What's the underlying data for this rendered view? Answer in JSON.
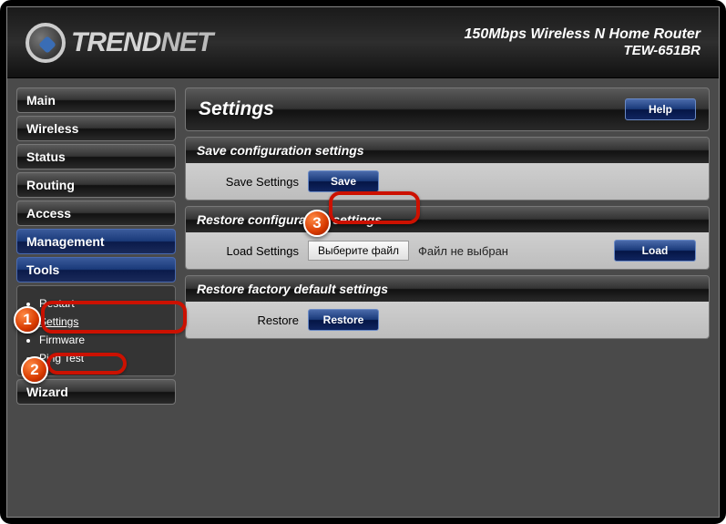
{
  "header": {
    "brand": "TRENDNET",
    "brand_part1": "TREND",
    "brand_part2": "NET",
    "line1": "150Mbps Wireless N Home Router",
    "line2": "TEW-651BR"
  },
  "nav": {
    "items": [
      {
        "label": "Main"
      },
      {
        "label": "Wireless"
      },
      {
        "label": "Status"
      },
      {
        "label": "Routing"
      },
      {
        "label": "Access"
      },
      {
        "label": "Management"
      },
      {
        "label": "Tools"
      },
      {
        "label": "Wizard"
      }
    ],
    "tools_sub": [
      {
        "label": "Restart"
      },
      {
        "label": "Settings"
      },
      {
        "label": "Firmware"
      },
      {
        "label": "Ping Test"
      }
    ]
  },
  "page": {
    "title": "Settings",
    "help": "Help"
  },
  "sections": {
    "save": {
      "title": "Save configuration settings",
      "label": "Save Settings",
      "button": "Save"
    },
    "restore": {
      "title": "Restore configuration settings",
      "label": "Load Settings",
      "file_button": "Выберите файл",
      "file_text": "Файл не выбран",
      "button": "Load"
    },
    "factory": {
      "title": "Restore factory default settings",
      "label": "Restore",
      "button": "Restore"
    }
  },
  "callouts": {
    "c1": "1",
    "c2": "2",
    "c3": "3"
  }
}
